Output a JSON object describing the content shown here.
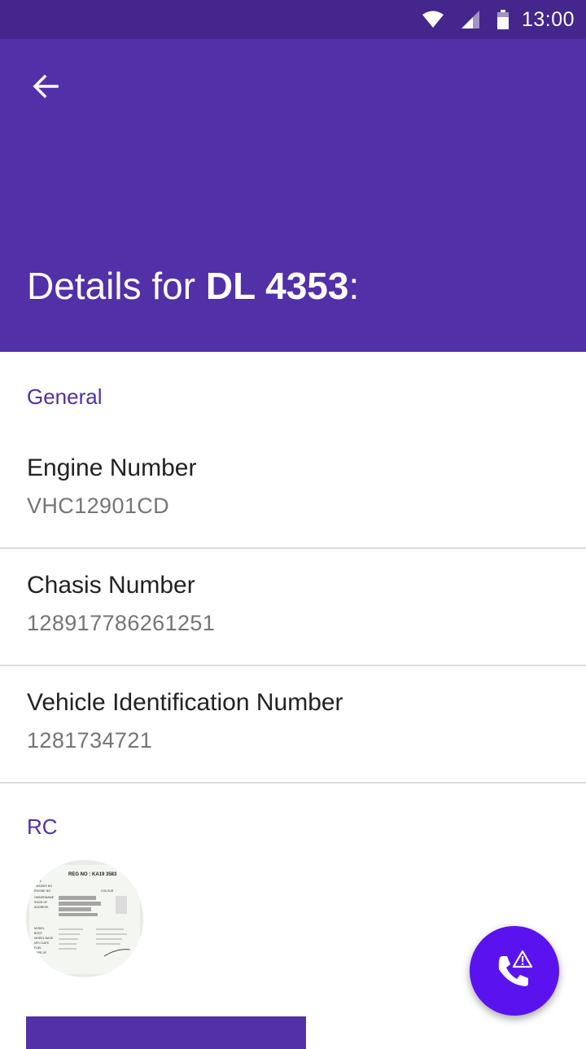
{
  "status_bar": {
    "time": "13:00",
    "icons": [
      "wifi-icon",
      "signal-icon",
      "battery-icon"
    ]
  },
  "app_bar": {
    "title_prefix": "Details for ",
    "title_vehicle": "DL 4353",
    "title_suffix": ":",
    "back_icon": "arrow-back-icon"
  },
  "sections": {
    "general": {
      "header": "General",
      "rows": [
        {
          "label": "Engine Number",
          "value": "VHC12901CD"
        },
        {
          "label": "Chasis Number",
          "value": "128917786261251"
        },
        {
          "label": "Vehicle Identification Number",
          "value": "1281734721"
        }
      ]
    },
    "rc": {
      "header": "RC",
      "image": {
        "reg_no": "REG NO : KA19 3583",
        "lines": [
          "DATE",
          "CHASSIS NO",
          "ENGINE NO",
          "OWNERNAME",
          "S/W/D OF",
          "ADDRESS",
          "MODEL",
          "BODY",
          "WHEEL BASE",
          "MFG DATE",
          "FUEL",
          "TYPE OF",
          "COLOUR"
        ]
      }
    }
  },
  "fab": {
    "icon": "phone-alert-icon"
  },
  "colors": {
    "status_bar": "#45268c",
    "primary": "#5230a8",
    "fab": "#5a13ee"
  }
}
